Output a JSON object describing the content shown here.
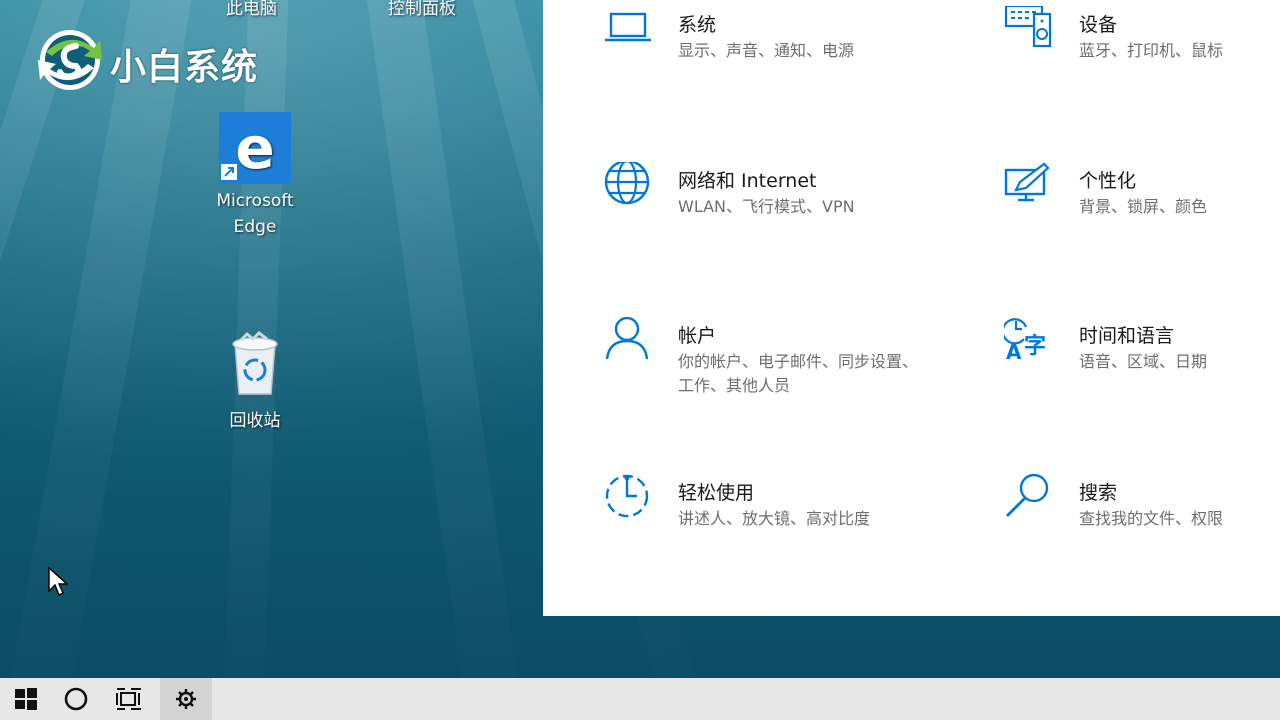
{
  "desktop": {
    "top_labels": [
      "此电脑",
      "控制面板"
    ],
    "watermark": "小白系统",
    "icons": [
      {
        "label_line1": "Microsoft",
        "label_line2": "Edge"
      },
      {
        "label": "回收站"
      }
    ]
  },
  "settings": {
    "categories": [
      {
        "title": "系统",
        "desc": "显示、声音、通知、电源",
        "icon": "laptop-icon"
      },
      {
        "title": "设备",
        "desc": "蓝牙、打印机、鼠标",
        "icon": "devices-icon"
      },
      {
        "title": "网络和 Internet",
        "desc": "WLAN、飞行模式、VPN",
        "icon": "globe-icon"
      },
      {
        "title": "个性化",
        "desc": "背景、锁屏、颜色",
        "icon": "personalization-icon"
      },
      {
        "title": "帐户",
        "desc": "你的帐户、电子邮件、同步设置、工作、其他人员",
        "icon": "person-icon"
      },
      {
        "title": "时间和语言",
        "desc": "语音、区域、日期",
        "icon": "time-language-icon"
      },
      {
        "title": "轻松使用",
        "desc": "讲述人、放大镜、高对比度",
        "icon": "ease-of-access-icon"
      },
      {
        "title": "搜索",
        "desc": "查找我的文件、权限",
        "icon": "search-icon"
      }
    ]
  },
  "taskbar": {
    "buttons": [
      "windows-start-icon",
      "cortana-circle-icon",
      "task-view-icon",
      "settings-gear-icon"
    ]
  },
  "colors": {
    "accent": "#0078d7",
    "panel_bg": "#ffffff",
    "taskbar_bg": "#e7e7e7"
  }
}
